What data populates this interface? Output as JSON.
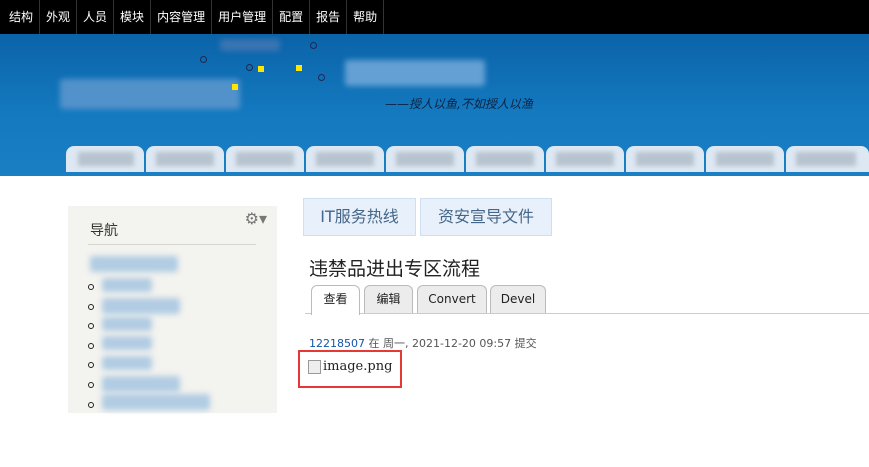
{
  "admin_menu": {
    "items": [
      "结构",
      "外观",
      "人员",
      "模块",
      "内容管理",
      "用户管理",
      "配置",
      "报告",
      "帮助"
    ]
  },
  "header": {
    "slogan": "——授人以鱼,不如授人以渔"
  },
  "sidebar": {
    "title": "导航",
    "gear_icon": "⚙▾"
  },
  "top_buttons": [
    "IT服务热线",
    "资安宣导文件"
  ],
  "page": {
    "title": "违禁品进出专区流程",
    "tabs": [
      "查看",
      "编辑",
      "Convert",
      "Devel"
    ],
    "active_tab": "查看",
    "author": "12218507",
    "submitted_text": " 在 周一, 2021-12-20 09:57 提交",
    "image_alt": "image.png"
  },
  "colors": {
    "header_blue": "#1479bf",
    "highlight_red": "#e53935",
    "admin_bar": "#000000"
  }
}
